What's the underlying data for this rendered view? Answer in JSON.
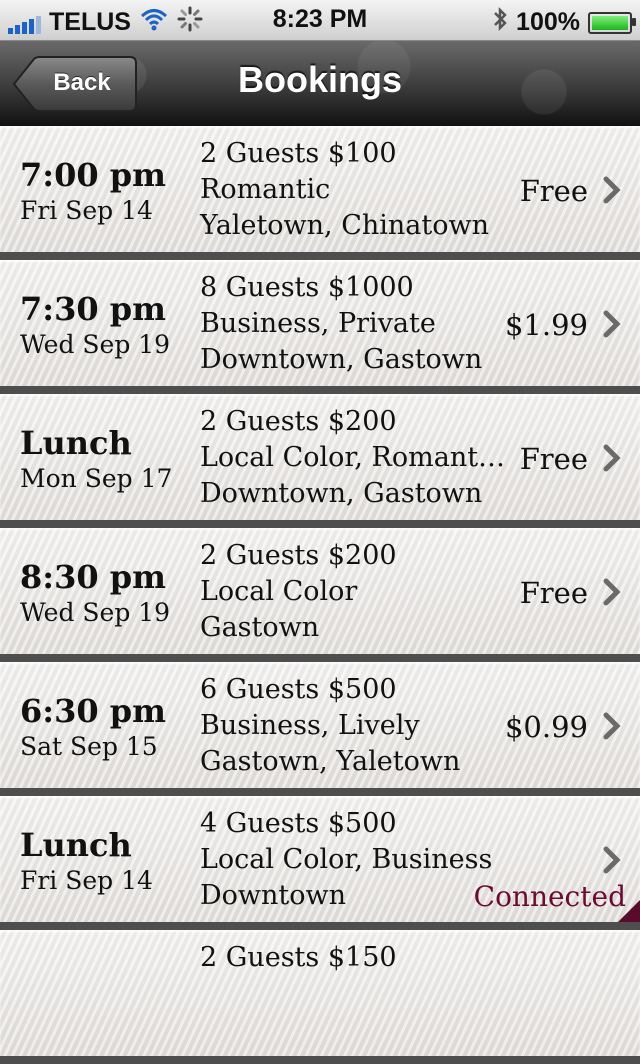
{
  "status_bar": {
    "carrier": "TELUS",
    "time": "8:23 PM",
    "battery": "100%",
    "icons": [
      "signal-icon",
      "wifi-icon",
      "activity-spinner-icon",
      "bluetooth-icon",
      "battery-icon"
    ]
  },
  "nav": {
    "back_label": "Back",
    "title": "Bookings"
  },
  "bookings": [
    {
      "time": "7:00 pm",
      "date": "Fri Sep 14",
      "guests": "2 Guests $100",
      "tags": "Romantic",
      "areas": "Yaletown, Chinatown",
      "price": "Free"
    },
    {
      "time": "7:30 pm",
      "date": "Wed Sep 19",
      "guests": "8 Guests $1000",
      "tags": "Business, Private",
      "areas": "Downtown, Gastown",
      "price": "$1.99"
    },
    {
      "time": "Lunch",
      "date": "Mon Sep 17",
      "guests": "2 Guests $200",
      "tags": "Local Color, Romant…",
      "areas": "Downtown, Gastown",
      "price": "Free"
    },
    {
      "time": "8:30 pm",
      "date": "Wed Sep 19",
      "guests": "2 Guests $200",
      "tags": "Local Color",
      "areas": "Gastown",
      "price": "Free"
    },
    {
      "time": "6:30 pm",
      "date": "Sat Sep 15",
      "guests": "6 Guests $500",
      "tags": "Business, Lively",
      "areas": "Gastown, Yaletown",
      "price": "$0.99"
    },
    {
      "time": "Lunch",
      "date": "Fri Sep 14",
      "guests": "4 Guests $500",
      "tags": "Local Color, Business",
      "areas": "Downtown",
      "price": "",
      "status": "Connected"
    },
    {
      "time": "",
      "date": "",
      "guests": "2 Guests $150",
      "tags": "",
      "areas": "",
      "price": ""
    }
  ],
  "colors": {
    "connected": "#6b0b31",
    "separator": "#4e4e4e"
  }
}
